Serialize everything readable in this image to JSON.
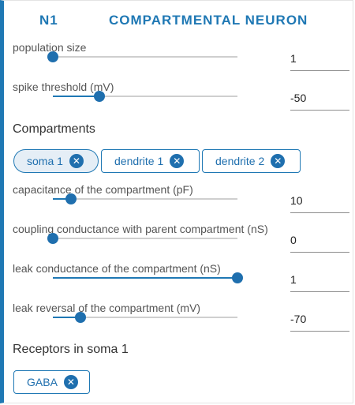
{
  "header": {
    "id": "N1",
    "title": "COMPARTMENTAL NEURON"
  },
  "params": [
    {
      "label": "population size",
      "value": "1",
      "level": 0.0
    },
    {
      "label": "spike threshold (mV)",
      "value": "-50",
      "level": 0.25
    }
  ],
  "compartments": {
    "title": "Compartments",
    "chips": [
      {
        "label": "soma 1",
        "selected": true
      },
      {
        "label": "dendrite 1",
        "selected": false
      },
      {
        "label": "dendrite 2",
        "selected": false
      }
    ],
    "params": [
      {
        "label": "capacitance of the compartment (pF)",
        "value": "10",
        "level": 0.1
      },
      {
        "label": "coupling conductance with parent compartment (nS)",
        "value": "0",
        "level": 0.0
      },
      {
        "label": "leak conductance of the compartment (nS)",
        "value": "1",
        "level": 1.0
      },
      {
        "label": "leak reversal of the compartment (mV)",
        "value": "-70",
        "level": 0.15
      }
    ]
  },
  "receptors": {
    "title": "Receptors in soma 1",
    "chips": [
      {
        "label": "GABA"
      }
    ]
  },
  "colors": {
    "accent": "#1f78b4",
    "track": "#cfcfcf",
    "chip_selected_bg": "#e5eef6"
  },
  "icons": {
    "chip_close": "close-circle-icon"
  }
}
